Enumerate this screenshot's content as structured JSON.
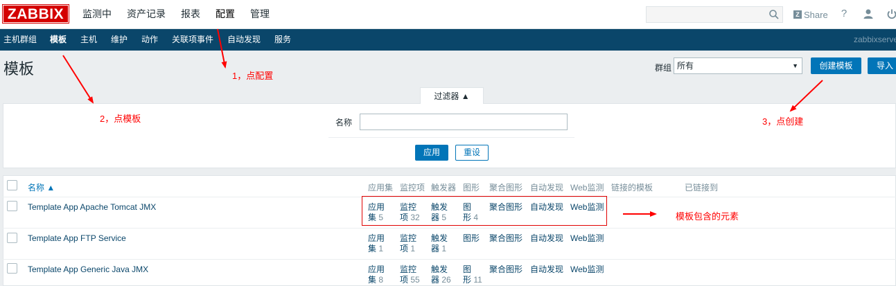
{
  "header": {
    "logo": "ZABBIX",
    "menu": [
      "监测中",
      "资产记录",
      "报表",
      "配置",
      "管理"
    ],
    "share": "Share",
    "help": "?"
  },
  "subnav": {
    "items": [
      "主机群组",
      "模板",
      "主机",
      "维护",
      "动作",
      "关联项事件",
      "自动发现",
      "服务"
    ],
    "server": "zabbixserver"
  },
  "page": {
    "title": "模板",
    "group_label": "群组",
    "group_value": "所有",
    "create_button": "创建模板",
    "import_button": "导入"
  },
  "filter": {
    "tab_label": "过滤器 ▲",
    "name_label": "名称",
    "name_value": "",
    "apply_button": "应用",
    "reset_button": "重设"
  },
  "table": {
    "columns": {
      "name": "名称 ▲",
      "apps": "应用集",
      "items": "监控项",
      "triggers": "触发器",
      "graphs": "图形",
      "screens": "聚合图形",
      "discovery": "自动发现",
      "web": "Web监测",
      "linked_templates": "链接的模板",
      "linked_to": "已链接到"
    },
    "rows": [
      {
        "name": "Template App Apache Tomcat JMX",
        "apps_l1": "应用",
        "apps_l2": "集",
        "apps_n": "5",
        "items_l1": "监控",
        "items_l2": "项",
        "items_n": "32",
        "triggers_l1": "触发",
        "triggers_l2": "器",
        "triggers_n": "5",
        "graphs_l1": "图",
        "graphs_l2": "形",
        "graphs_n": "4",
        "screens": "聚合图形",
        "discovery": "自动发现",
        "web": "Web监测"
      },
      {
        "name": "Template App FTP Service",
        "apps_l1": "应用",
        "apps_l2": "集",
        "apps_n": "1",
        "items_l1": "监控",
        "items_l2": "项",
        "items_n": "1",
        "triggers_l1": "触发",
        "triggers_l2": "器",
        "triggers_n": "1",
        "graphs_l1": "图形",
        "graphs_l2": "",
        "graphs_n": "",
        "screens": "聚合图形",
        "discovery": "自动发现",
        "web": "Web监测"
      },
      {
        "name": "Template App Generic Java JMX",
        "apps_l1": "应用",
        "apps_l2": "集",
        "apps_n": "8",
        "items_l1": "监控",
        "items_l2": "项",
        "items_n": "55",
        "triggers_l1": "触发",
        "triggers_l2": "器",
        "triggers_n": "26",
        "graphs_l1": "图",
        "graphs_l2": "形",
        "graphs_n": "11",
        "screens": "聚合图形",
        "discovery": "自动发现",
        "web": "Web监测"
      }
    ]
  },
  "annotations": {
    "step1": "1，点配置",
    "step2": "2，点模板",
    "step3": "3，点创建",
    "elements": "模板包含的元素"
  },
  "colors": {
    "logo_red": "#d40000",
    "subnav_bg": "#0a466a",
    "primary_blue": "#0275b8",
    "annotation_red": "#ff0000"
  }
}
